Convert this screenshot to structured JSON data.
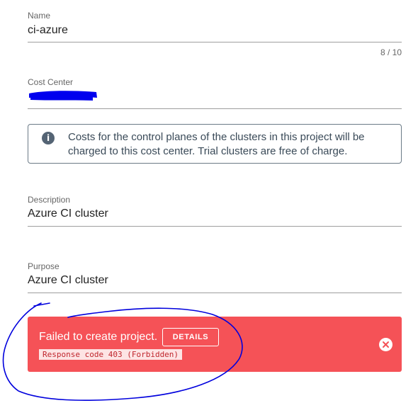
{
  "form": {
    "name": {
      "label": "Name",
      "value": "ci-azure",
      "counter": "8 / 10"
    },
    "cost_center": {
      "label": "Cost Center",
      "value_redacted": true
    },
    "info": {
      "icon": "info-icon",
      "text": "Costs for the control planes of the clusters in this project will be charged to this cost center. Trial clusters are free of charge."
    },
    "description": {
      "label": "Description",
      "value": "Azure CI cluster"
    },
    "purpose": {
      "label": "Purpose",
      "value": "Azure CI cluster"
    }
  },
  "error": {
    "title": "Failed to create project.",
    "details_label": "DETAILS",
    "code": "Response code 403 (Forbidden)",
    "close_icon": "close-icon"
  },
  "colors": {
    "error_bg": "#f55257",
    "info_icon": "#546474",
    "annotation": "#0000dd",
    "redaction": "#0000ee"
  }
}
